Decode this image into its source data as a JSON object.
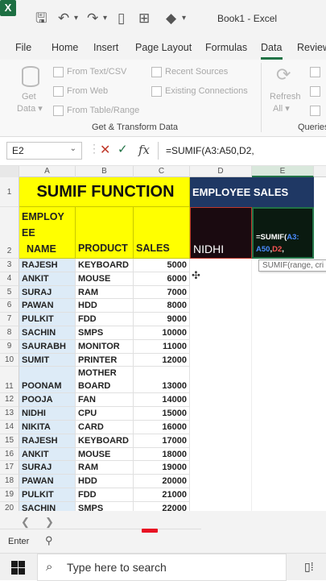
{
  "window": {
    "title": "Book1 - Excel"
  },
  "tabs": [
    "File",
    "Home",
    "Insert",
    "Page Layout",
    "Formulas",
    "Data",
    "Review"
  ],
  "ribbon": {
    "get_data": [
      "Get",
      "Data ▾"
    ],
    "from_text_csv": "From Text/CSV",
    "from_web": "From Web",
    "from_table_range": "From Table/Range",
    "recent_sources": "Recent Sources",
    "existing_connections": "Existing Connections",
    "refresh": [
      "Refresh",
      "All ▾"
    ],
    "group_label": "Get & Transform Data",
    "queries_label": "Queries"
  },
  "formula_bar": {
    "cell_ref": "E2",
    "formula": "=SUMIF(A3:A50,D2,"
  },
  "columns": [
    "A",
    "B",
    "C",
    "D",
    "E"
  ],
  "header": {
    "title": "SUMIF FUNCTION",
    "employee_sales": "EMPLOYEE  SALES",
    "col_a": [
      "EMPLOY",
      "EE",
      "NAME"
    ],
    "col_b": "PRODUCT",
    "col_c": "SALES",
    "d2": "NIDHI",
    "e2_parts": [
      "=SUMIF(",
      "A3:",
      "A50",
      ",",
      "D2",
      ","
    ],
    "tooltip": "SUMIF(range, cri"
  },
  "rows": [
    {
      "n": "3",
      "name": "RAJESH",
      "product": "KEYBOARD",
      "sales": "5000"
    },
    {
      "n": "4",
      "name": "ANKIT",
      "product": "MOUSE",
      "sales": "6000"
    },
    {
      "n": "5",
      "name": "SURAJ",
      "product": "RAM",
      "sales": "7000"
    },
    {
      "n": "6",
      "name": "PAWAN",
      "product": "HDD",
      "sales": "8000"
    },
    {
      "n": "7",
      "name": "PULKIT",
      "product": "FDD",
      "sales": "9000"
    },
    {
      "n": "8",
      "name": "SACHIN",
      "product": "SMPS",
      "sales": "10000"
    },
    {
      "n": "9",
      "name": "SAURABH",
      "product": "MONITOR",
      "sales": "11000"
    },
    {
      "n": "10",
      "name": "SUMIT",
      "product": "PRINTER",
      "sales": "12000"
    },
    {
      "n": "11",
      "name": "POONAM",
      "product": "MOTHER",
      "product2": "BOARD",
      "sales": "13000"
    },
    {
      "n": "12",
      "name": "POOJA",
      "product": "FAN",
      "sales": "14000"
    },
    {
      "n": "13",
      "name": "NIDHI",
      "product": "CPU",
      "sales": "15000"
    },
    {
      "n": "14",
      "name": "NIKITA",
      "product": "CARD",
      "sales": "16000"
    },
    {
      "n": "15",
      "name": "RAJESH",
      "product": "KEYBOARD",
      "sales": "17000"
    },
    {
      "n": "16",
      "name": "ANKIT",
      "product": "MOUSE",
      "sales": "18000"
    },
    {
      "n": "17",
      "name": "SURAJ",
      "product": "RAM",
      "sales": "19000"
    },
    {
      "n": "18",
      "name": "PAWAN",
      "product": "HDD",
      "sales": "20000"
    },
    {
      "n": "19",
      "name": "PULKIT",
      "product": "FDD",
      "sales": "21000"
    },
    {
      "n": "20",
      "name": "SACHIN",
      "product": "SMPS",
      "sales": "22000"
    }
  ],
  "status": {
    "mode": "Enter"
  },
  "taskbar": {
    "search_placeholder": "Type here to search"
  },
  "colors": {
    "excel_green": "#217346",
    "yellow": "#ffff00",
    "navy": "#1f3864",
    "dark_cell": "#1a0a10",
    "colA_fill": "#ddebf7"
  }
}
